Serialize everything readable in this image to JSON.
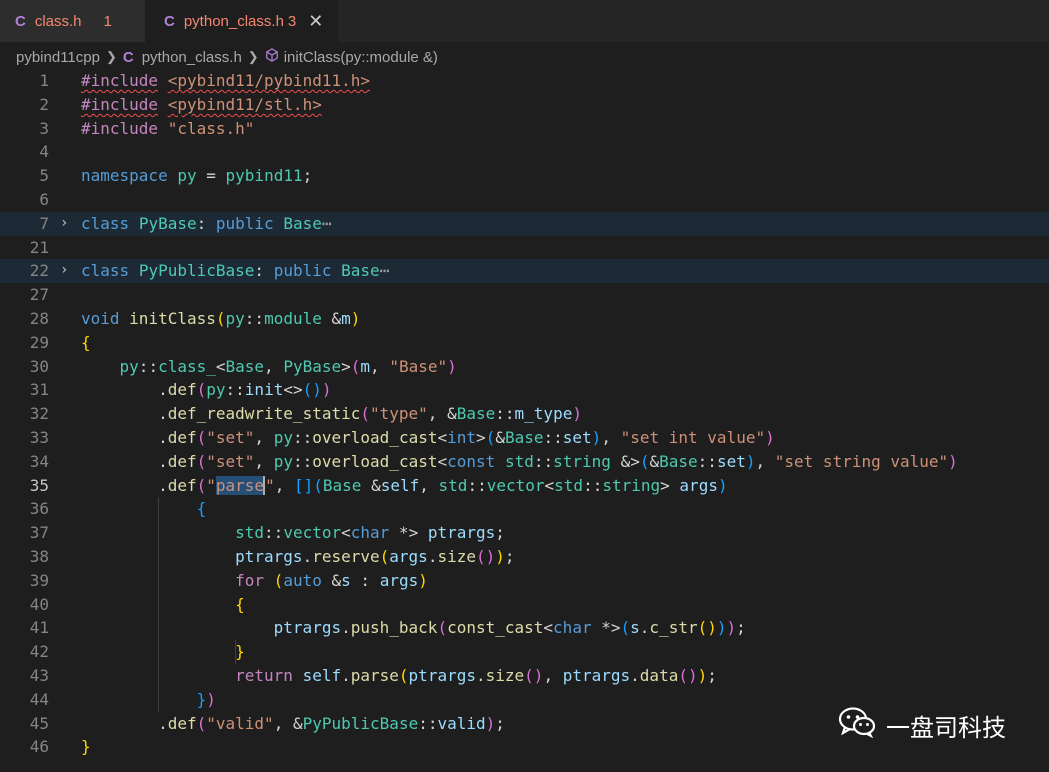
{
  "tabs": [
    {
      "icon": "C",
      "name": "class.h",
      "count": "1"
    },
    {
      "icon": "C",
      "name": "python_class.h",
      "count": "3",
      "close": "✕"
    }
  ],
  "breadcrumb": {
    "folder": "pybind11cpp",
    "file_icon": "C",
    "file": "python_class.h",
    "method": "initClass(py::module &)"
  },
  "lines": [
    {
      "n": "1",
      "text": "#include <pybind11/pybind11.h>"
    },
    {
      "n": "2",
      "text": "#include <pybind11/stl.h>"
    },
    {
      "n": "3",
      "text": "#include \"class.h\""
    },
    {
      "n": "4",
      "text": ""
    },
    {
      "n": "5",
      "text": "namespace py = pybind11;"
    },
    {
      "n": "6",
      "text": ""
    },
    {
      "n": "7",
      "text": "class PyBase: public Base",
      "folded": true
    },
    {
      "n": "21",
      "text": ""
    },
    {
      "n": "22",
      "text": "class PyPublicBase: public Base",
      "folded": true
    },
    {
      "n": "27",
      "text": ""
    },
    {
      "n": "28",
      "text": "void initClass(py::module &m)"
    },
    {
      "n": "29",
      "text": "{"
    },
    {
      "n": "30",
      "text": "    py::class_<Base, PyBase>(m, \"Base\")"
    },
    {
      "n": "31",
      "text": "        .def(py::init<>())"
    },
    {
      "n": "32",
      "text": "        .def_readwrite_static(\"type\", &Base::m_type)"
    },
    {
      "n": "33",
      "text": "        .def(\"set\", py::overload_cast<int>(&Base::set), \"set int value\")"
    },
    {
      "n": "34",
      "text": "        .def(\"set\", py::overload_cast<const std::string &>(&Base::set), \"set string value\")"
    },
    {
      "n": "35",
      "text": "        .def(\"parse\", [](Base &self, std::vector<std::string> args)",
      "current": true
    },
    {
      "n": "36",
      "text": "            {"
    },
    {
      "n": "37",
      "text": "                std::vector<char *> ptrargs;"
    },
    {
      "n": "38",
      "text": "                ptrargs.reserve(args.size());"
    },
    {
      "n": "39",
      "text": "                for (auto &s : args)"
    },
    {
      "n": "40",
      "text": "                {"
    },
    {
      "n": "41",
      "text": "                    ptrargs.push_back(const_cast<char *>(s.c_str()));"
    },
    {
      "n": "42",
      "text": "                }"
    },
    {
      "n": "43",
      "text": "                return self.parse(ptrargs.size(), ptrargs.data());"
    },
    {
      "n": "44",
      "text": "            })"
    },
    {
      "n": "45",
      "text": "        .def(\"valid\", &PyPublicBase::valid);"
    },
    {
      "n": "46",
      "text": "}"
    }
  ],
  "fold_ellipsis": "⋯",
  "fold_chevron": "›",
  "watermark": {
    "icon": "wechat-icon",
    "text": "一盘司科技"
  },
  "colors": {
    "background": "#1e1e1e",
    "keyword": "#569cd6",
    "type": "#4ec9b0",
    "string": "#ce9178",
    "function": "#dcdcaa",
    "variable": "#9cdcfe",
    "preprocessor": "#c586c0",
    "error": "#f48771"
  }
}
